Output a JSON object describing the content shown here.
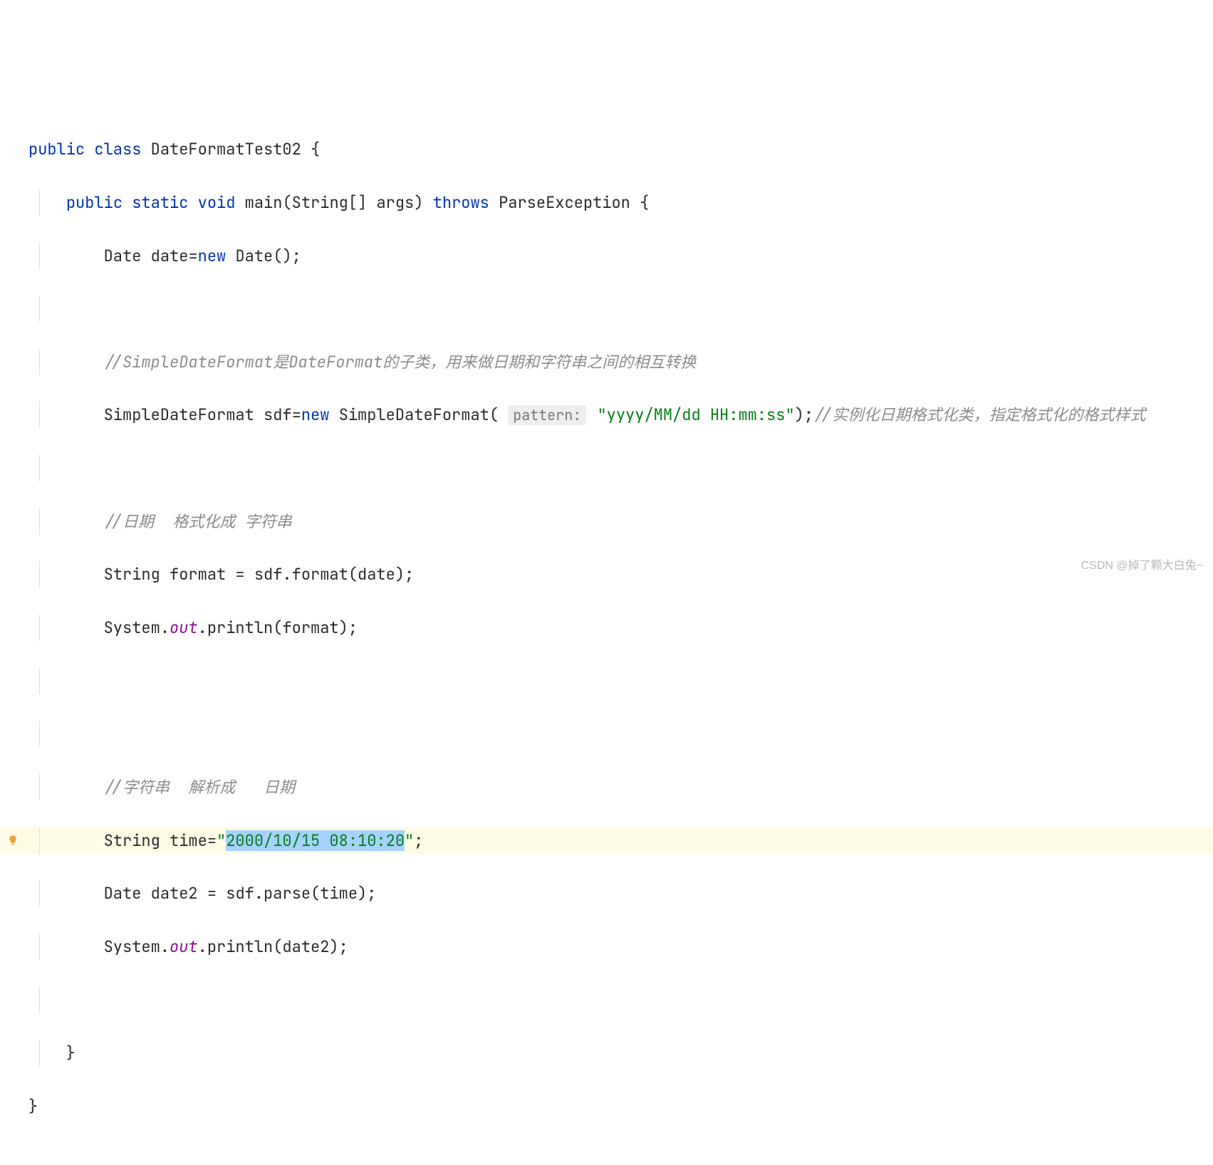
{
  "code": {
    "kw_public": "public",
    "kw_class": "class",
    "class_name": "DateFormatTest02",
    "kw_static": "static",
    "kw_void": "void",
    "method_main": "main",
    "main_params": "(String[] args)",
    "kw_throws": "throws",
    "exception": "ParseException",
    "type_date": "Date",
    "var_date": "date",
    "kw_new": "new",
    "ctor_date": "Date()",
    "comment_sdf": "//SimpleDateFormat是DateFormat的子类，用来做日期和字符串之间的相互转换",
    "type_sdf": "SimpleDateFormat",
    "var_sdf": "sdf",
    "ctor_sdf": "SimpleDateFormat(",
    "hint_pattern": "pattern:",
    "str_pattern": "\"yyyy/MM/dd HH:mm:ss\"",
    "comment_sdf_end": "//实例化日期格式化类，指定格式化的格式样式",
    "comment_format": "//日期  格式化成 字符串",
    "type_string": "String",
    "var_format": "format",
    "call_format": "sdf.format(date)",
    "sys": "System",
    "out": "out",
    "println_format": ".println(format)",
    "comment_parse": "//字符串  解析成   日期",
    "var_time": "time",
    "str_time_q1": "\"",
    "str_time_sel": "2000/10/15 08:10:20",
    "str_time_q2": "\"",
    "var_date2": "date2",
    "call_parse": "sdf.parse(time)",
    "println_date2": ".println(date2)"
  },
  "watermark": "CSDN @掉了颗大白兔~"
}
